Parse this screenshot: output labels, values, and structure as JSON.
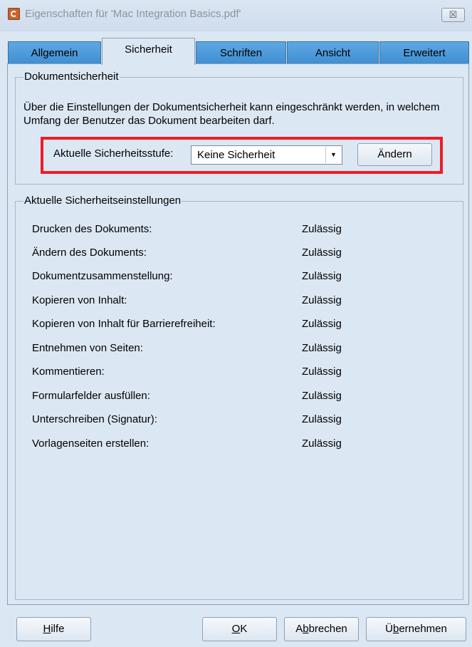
{
  "window": {
    "title": "Eigenschaften für 'Mac Integration Basics.pdf'",
    "close_label": "☒"
  },
  "tabs": [
    {
      "label": "Allgemein",
      "active": false
    },
    {
      "label": "Sicherheit",
      "active": true
    },
    {
      "label": "Schriften",
      "active": false
    },
    {
      "label": "Ansicht",
      "active": false
    },
    {
      "label": "Erweitert",
      "active": false
    }
  ],
  "security": {
    "group_title": "Dokumentsicherheit",
    "description": "Über die Einstellungen der Dokumentsicherheit kann eingeschränkt werden, in welchem Umfang der Benutzer das Dokument bearbeiten darf.",
    "level_label": "Aktuelle Sicherheitsstufe:",
    "level_value": "Keine Sicherheit",
    "change_button": "Ändern",
    "highlight_color": "#ee1c25"
  },
  "settings": {
    "group_title": "Aktuelle Sicherheitseinstellungen",
    "rows": [
      {
        "label": "Drucken des Dokuments:",
        "value": "Zulässig"
      },
      {
        "label": "Ändern des Dokuments:",
        "value": "Zulässig"
      },
      {
        "label": "Dokumentzusammenstellung:",
        "value": "Zulässig"
      },
      {
        "label": "Kopieren von Inhalt:",
        "value": "Zulässig"
      },
      {
        "label": "Kopieren von Inhalt für Barrierefreiheit:",
        "value": "Zulässig"
      },
      {
        "label": "Entnehmen von Seiten:",
        "value": "Zulässig"
      },
      {
        "label": "Kommentieren:",
        "value": "Zulässig"
      },
      {
        "label": "Formularfelder ausfüllen:",
        "value": "Zulässig"
      },
      {
        "label": "Unterschreiben (Signatur):",
        "value": "Zulässig"
      },
      {
        "label": "Vorlagenseiten erstellen:",
        "value": "Zulässig"
      }
    ]
  },
  "buttons": {
    "help_mnemonic": "H",
    "help_rest": "ilfe",
    "ok_mnemonic": "O",
    "ok_rest": "K",
    "cancel_first": "A",
    "cancel_mnemonic": "b",
    "cancel_rest": "brechen",
    "apply_first": "Ü",
    "apply_mnemonic": "b",
    "apply_rest": "ernehmen"
  }
}
